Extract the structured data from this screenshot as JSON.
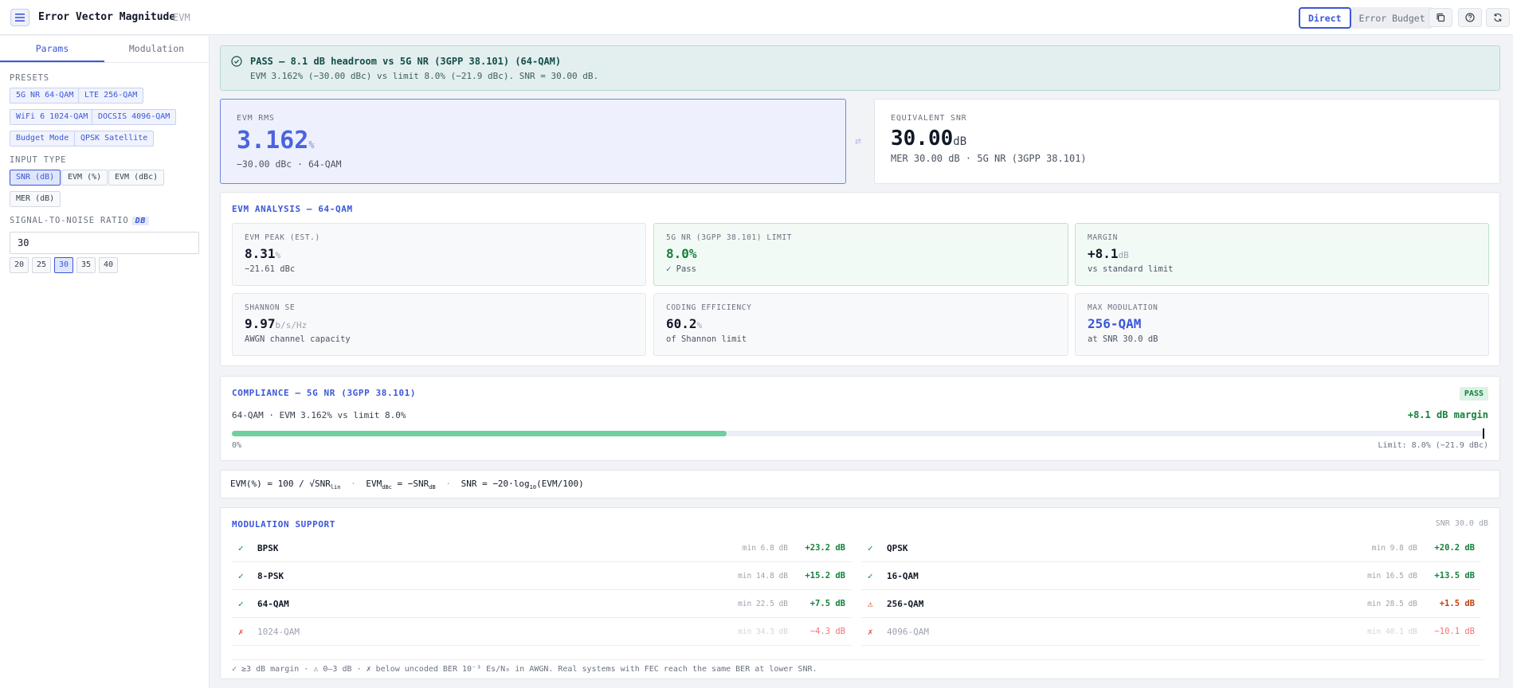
{
  "header": {
    "title": "Error Vector Magnitude",
    "subtitle": "EVM",
    "modes": [
      "Direct",
      "Error Budget"
    ],
    "active_mode": "Direct",
    "icons": [
      "copy-icon",
      "help-icon",
      "refresh-icon"
    ]
  },
  "sidebar": {
    "tabs": [
      "Params",
      "Modulation"
    ],
    "active_tab": "Params",
    "presets_label": "PRESETS",
    "presets": [
      "5G NR 64-QAM",
      "LTE 256-QAM",
      "WiFi 6 1024-QAM",
      "DOCSIS 4096-QAM",
      "Budget Mode",
      "QPSK Satellite"
    ],
    "input_type_label": "INPUT TYPE",
    "input_types": [
      "SNR (dB)",
      "EVM (%)",
      "EVM (dBc)",
      "MER (dB)"
    ],
    "selected_input_type": "SNR (dB)",
    "snr_label": "SIGNAL-TO-NOISE RATIO",
    "snr_unit": "DB",
    "snr_value": "30",
    "quick_values": [
      "20",
      "25",
      "30",
      "35",
      "40"
    ],
    "selected_quick": "30"
  },
  "banner": {
    "title": "PASS — 8.1 dB headroom vs 5G NR (3GPP 38.101) (64-QAM)",
    "detail": "EVM 3.162% (−30.00 dBc) vs limit 8.0% (−21.9 dBc). SNR = 30.00 dB.",
    "color": "#15803d"
  },
  "evm_card": {
    "label": "EVM RMS",
    "value": "3.162",
    "unit": "%",
    "sub": "−30.00 dBc · 64-QAM"
  },
  "snr_card": {
    "label": "EQUIVALENT SNR",
    "value": "30.00",
    "unit": "dB",
    "sub": "MER 30.00 dB · 5G NR (3GPP 38.101)"
  },
  "analysis": {
    "title": "EVM ANALYSIS — 64-QAM",
    "cells": [
      {
        "label": "EVM PEAK (EST.)",
        "value": "8.31",
        "unit": "%",
        "sub": "−21.61 dBc"
      },
      {
        "label": "5G NR (3GPP 38.101) LIMIT",
        "value": "8.0%",
        "unit": "",
        "sub": "✓ Pass"
      },
      {
        "label": "MARGIN",
        "value": "+8.1",
        "unit": "dB",
        "sub": "vs standard limit"
      },
      {
        "label": "SHANNON SE",
        "value": "9.97",
        "unit": "b/s/Hz",
        "sub": "AWGN channel capacity"
      },
      {
        "label": "CODING EFFICIENCY",
        "value": "60.2",
        "unit": "%",
        "sub": "of Shannon limit"
      },
      {
        "label": "MAX MODULATION",
        "value": "256-QAM",
        "unit": "",
        "sub": "at SNR 30.0 dB"
      }
    ]
  },
  "compliance": {
    "title": "COMPLIANCE — 5G NR (3GPP 38.101)",
    "badge": "PASS",
    "summary": "64-QAM · EVM 3.162% vs limit 8.0%",
    "margin": "+8.1 dB margin",
    "fill_fraction": 0.395,
    "bar_start_label": "0%",
    "bar_end_label": "Limit: 8.0% (−21.9 dBc)"
  },
  "formula": {
    "evm_pct": "EVM(%) = 100 / √SNR",
    "evm_pct_sub": "lin",
    "evm_dbc": "EVM",
    "evm_dbc_sub": "dBc",
    "evm_dbc_rhs": " = −SNR",
    "evm_dbc_rhs_sub": "dB",
    "snr": "SNR = −20·log",
    "snr_sub": "10",
    "snr_tail": "(EVM/100)",
    "sep": "·"
  },
  "modulation": {
    "title": "MODULATION SUPPORT",
    "snr_note": "SNR 30.0 dB",
    "rows": [
      {
        "name": "BPSK",
        "min": "min 6.8 dB",
        "margin": "+23.2 dB",
        "status": "ok"
      },
      {
        "name": "QPSK",
        "min": "min 9.8 dB",
        "margin": "+20.2 dB",
        "status": "ok"
      },
      {
        "name": "8-PSK",
        "min": "min 14.8 dB",
        "margin": "+15.2 dB",
        "status": "ok"
      },
      {
        "name": "16-QAM",
        "min": "min 16.5 dB",
        "margin": "+13.5 dB",
        "status": "ok"
      },
      {
        "name": "64-QAM",
        "min": "min 22.5 dB",
        "margin": "+7.5 dB",
        "status": "ok"
      },
      {
        "name": "256-QAM",
        "min": "min 28.5 dB",
        "margin": "+1.5 dB",
        "status": "warn"
      },
      {
        "name": "1024-QAM",
        "min": "min 34.3 dB",
        "margin": "−4.3 dB",
        "status": "bad"
      },
      {
        "name": "4096-QAM",
        "min": "min 40.1 dB",
        "margin": "−10.1 dB",
        "status": "bad"
      }
    ],
    "legend": "✓ ≥3 dB margin  ·  ⚠ 0–3 dB  ·  ✗ below uncoded BER 10⁻³ Es/N₀ in AWGN. Real systems with FEC reach the same BER at lower SNR."
  }
}
